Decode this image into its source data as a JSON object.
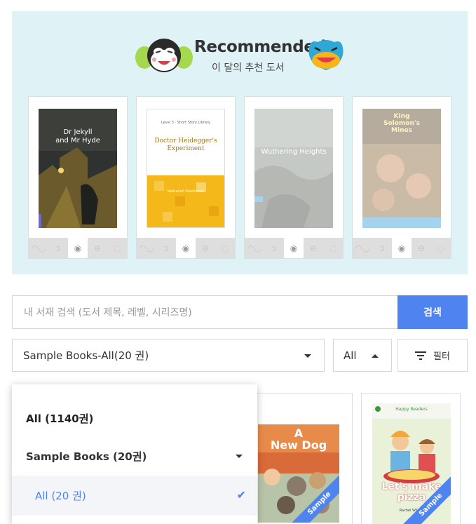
{
  "recommended": {
    "title": "Recommended",
    "subtitle": "이 달의 추천 도서",
    "books": [
      {
        "title_line1": "Dr Jekyll",
        "title_line2": "and Mr Hyde",
        "dimmed": false
      },
      {
        "series": "Level 3 · Short Story Library",
        "title_line1": "Doctor Heidegger's",
        "title_line2": "Experiment",
        "author": "Nathaniel Hawthorne",
        "dimmed": false
      },
      {
        "title_line1": "Wuthering Heights",
        "dimmed": true
      },
      {
        "title_line1": "King",
        "title_line2": "Solomon's",
        "title_line3": "Mines",
        "dimmed": true
      }
    ],
    "card_icons": [
      "headphones-icon",
      "ear-icon",
      "eye-icon",
      "glasses-icon",
      "speech-icon"
    ]
  },
  "search": {
    "placeholder": "내 서재 검색 (도서 제목, 레벨, 시리즈명)",
    "button_label": "검색"
  },
  "filters": {
    "main_select": "Sample Books-All(20 권)",
    "level_select": "All",
    "filter_button": "필터"
  },
  "grid_books": [
    {
      "title_line1": "A",
      "title_line2": "New Dog",
      "badge": "Sample"
    },
    {
      "brand": "Happy Readers",
      "title_line1": "Let's make",
      "title_line2": "pizza",
      "author": "Rachel Wilson",
      "badge": "Sample"
    }
  ],
  "dropdown": {
    "all_label": "All (1140권)",
    "sample_label": "Sample Books (20권)",
    "sub_all_label": "All (20 권)"
  },
  "colors": {
    "accent": "#4f84f0",
    "rec_bg": "#dff3f6"
  }
}
